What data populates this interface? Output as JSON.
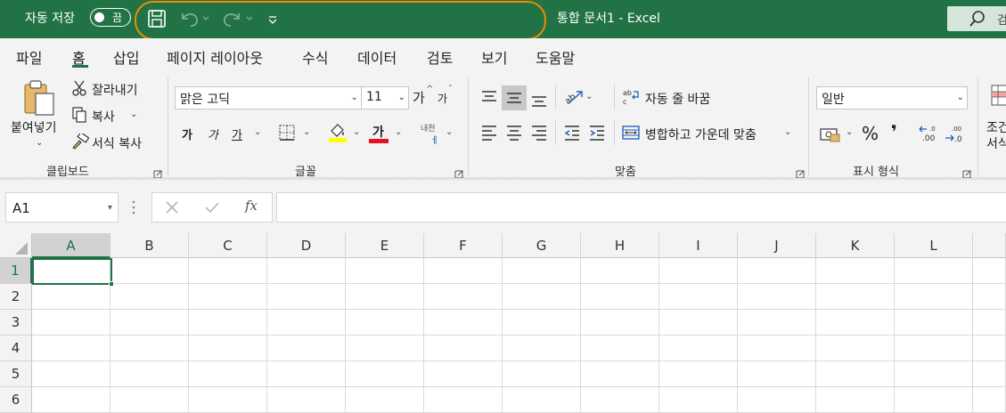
{
  "titlebar": {
    "autosave_label": "자동 저장",
    "autosave_state": "끔",
    "document_title": "통합 문서1  -  Excel",
    "save_icon": "save-icon",
    "undo_icon": "undo-icon",
    "redo_icon": "redo-icon",
    "customize_icon": "customize-qat-icon",
    "search_icon": "search-icon",
    "search_cut_text": "검",
    "bg_color": "#217346",
    "highlight_color": "#f08a00"
  },
  "tabs": [
    {
      "label": "파일"
    },
    {
      "label": "홈",
      "active": true
    },
    {
      "label": "삽입"
    },
    {
      "label": "페이지 레이아웃"
    },
    {
      "label": "수식"
    },
    {
      "label": "데이터"
    },
    {
      "label": "검토"
    },
    {
      "label": "보기"
    },
    {
      "label": "도움말"
    }
  ],
  "ribbon": {
    "clipboard": {
      "label": "클립보드",
      "paste_label": "붙여넣기",
      "cut_label": "잘라내기",
      "copy_label": "복사",
      "format_painter_label": "서식 복사"
    },
    "font": {
      "label": "글꼴",
      "font_name": "맑은 고딕",
      "font_size": "11",
      "grow_label": "가",
      "shrink_label": "가",
      "bold_label": "가",
      "italic_label": "가",
      "underline_label": "가",
      "font_color_label": "가",
      "phonetic_label": "내천",
      "fill_color": "#ffff00",
      "font_color": "#e81123"
    },
    "alignment": {
      "label": "맞춤",
      "wrap_text_label": "자동 줄 바꿈",
      "merge_center_label": "병합하고 가운데 맞춤",
      "orientation_icon_text": "ab"
    },
    "number": {
      "label": "표시 형식",
      "format_value": "일반",
      "percent_label": "%",
      "comma_label": "❜"
    },
    "styles": {
      "conditional_cut_1": "조건",
      "conditional_cut_2": "서식"
    }
  },
  "formula_bar": {
    "name_box": "A1",
    "cancel_icon": "cancel-icon",
    "enter_icon": "check-icon",
    "fx_label": "fx",
    "formula_value": ""
  },
  "grid": {
    "columns": [
      "A",
      "B",
      "C",
      "D",
      "E",
      "F",
      "G",
      "H",
      "I",
      "J",
      "K",
      "L"
    ],
    "rows": [
      "1",
      "2",
      "3",
      "4",
      "5",
      "6"
    ],
    "active_cell": "A1"
  }
}
